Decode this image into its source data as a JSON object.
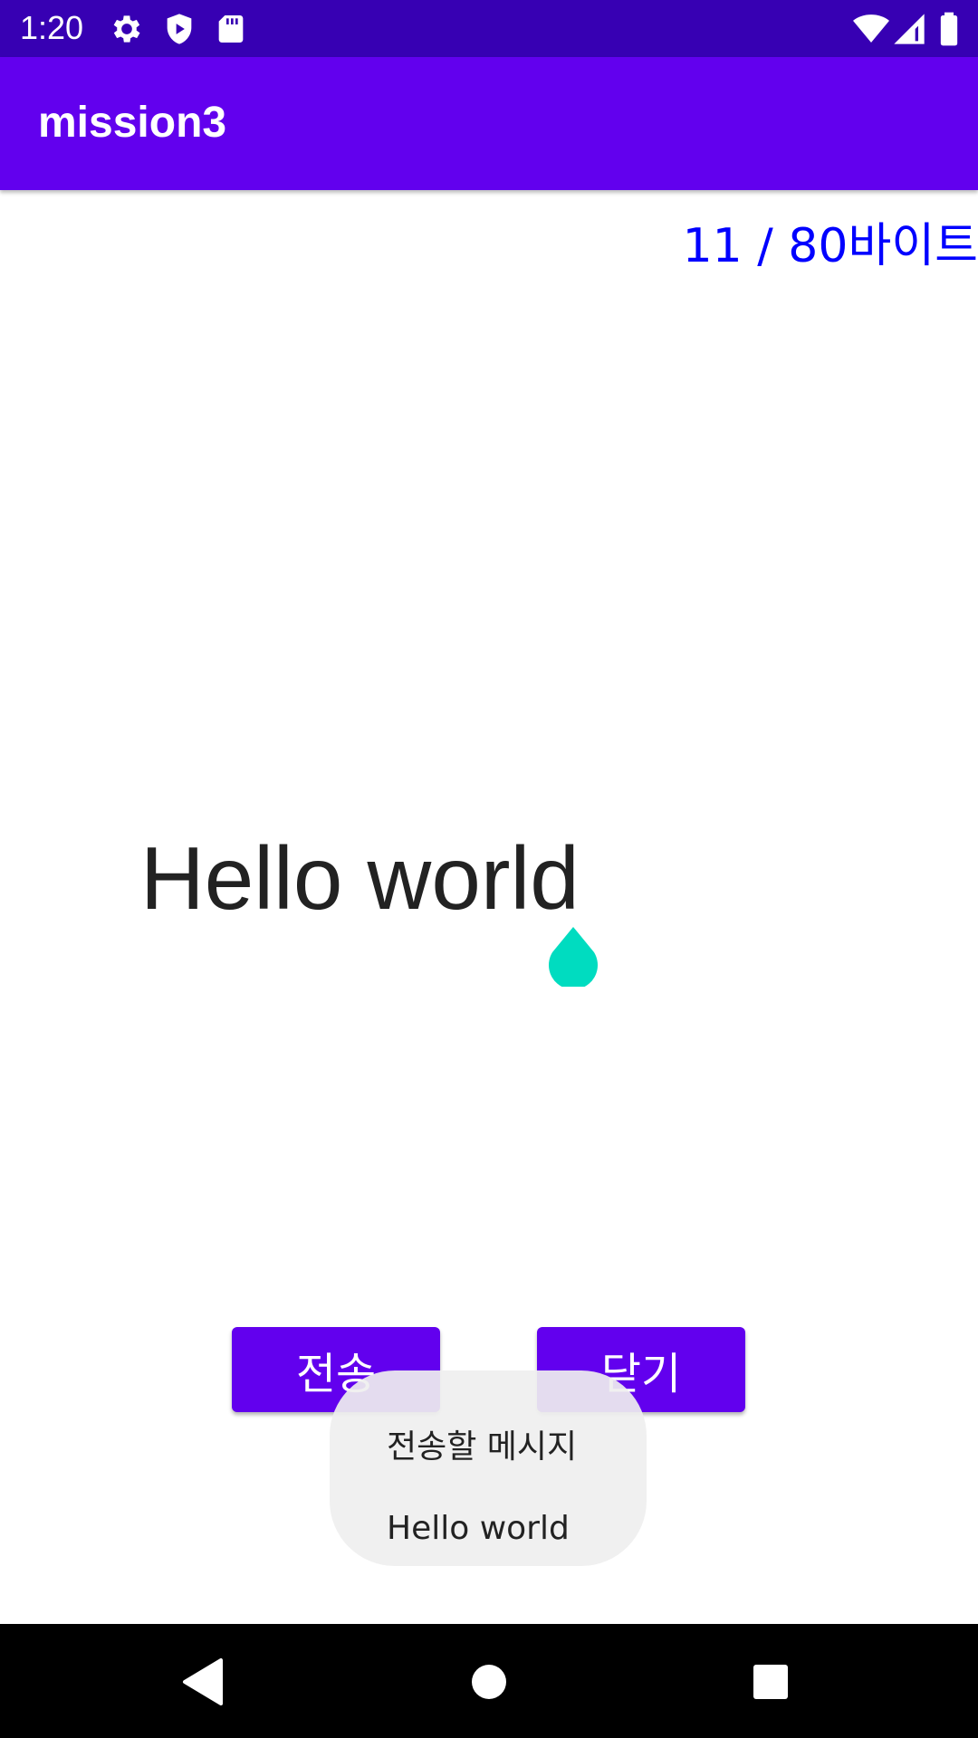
{
  "status_bar": {
    "time": "1:20",
    "icons_left": [
      "gear-icon",
      "shield-play-icon",
      "sd-card-icon"
    ],
    "icons_right": [
      "wifi-icon",
      "signal-icon",
      "battery-icon"
    ],
    "background": "#3700B3"
  },
  "app_bar": {
    "title": "mission3",
    "background": "#6200EE"
  },
  "byte_counter": {
    "text": "11 / 80바이트",
    "color": "#0000FF"
  },
  "message_input": {
    "value": "Hello world",
    "cursor_handle_color": "#00DCC0"
  },
  "buttons": {
    "send_label": "전송",
    "close_label": "닫기",
    "color": "#6200EE"
  },
  "toast": {
    "line1": "전송할 메시지",
    "line2": "Hello world"
  },
  "nav_bar": {
    "icons": [
      "back-icon",
      "home-icon",
      "recents-icon"
    ]
  }
}
